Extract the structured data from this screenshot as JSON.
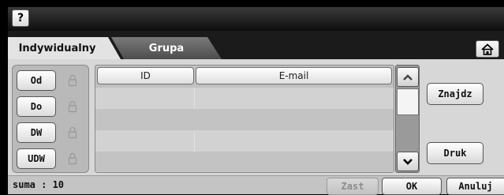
{
  "header": {
    "help_label": "?"
  },
  "tabs": [
    {
      "label": "Indywidualny",
      "active": true
    },
    {
      "label": "Grupa",
      "active": false
    }
  ],
  "icons": {
    "home": "home-icon",
    "lock": "lock-icon",
    "scroll_up": "chevron-up-icon",
    "scroll_down": "chevron-down-icon"
  },
  "filters": [
    {
      "label": "Od"
    },
    {
      "label": "Do"
    },
    {
      "label": "DW"
    },
    {
      "label": "UDW"
    }
  ],
  "table": {
    "columns": [
      "ID",
      "E-mail"
    ],
    "rows": [
      {
        "id": "",
        "email": ""
      },
      {
        "id": "",
        "email": ""
      },
      {
        "id": "",
        "email": ""
      },
      {
        "id": "",
        "email": ""
      }
    ]
  },
  "actions": {
    "search": "Znajdz",
    "print": "Druk"
  },
  "footer": {
    "total": "suma : 10",
    "apply": "Zast",
    "ok": "OK",
    "cancel": "Anuluj"
  },
  "colors": {
    "background": "#000000",
    "panel": "#c9c9c9",
    "tab_active": "#e3e3e3",
    "tab_inactive": "#5e5e5e"
  }
}
